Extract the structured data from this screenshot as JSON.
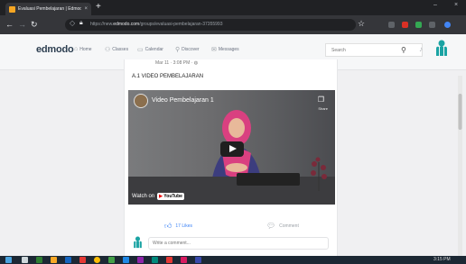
{
  "browser": {
    "tab_title": "Evaluasi Pembelajaran | Edmodo",
    "tab_close": "×",
    "new_tab": "+",
    "url_prefix": "https://new.",
    "url_domain": "edmodo.com",
    "url_path": "/groups/evaluasi-pembelajaran-37355993",
    "window_controls": [
      "–",
      "×"
    ]
  },
  "header": {
    "logo": "edmodo",
    "nav": [
      {
        "label": "Home",
        "icon": "home-icon"
      },
      {
        "label": "Classes",
        "icon": "classes-icon"
      },
      {
        "label": "Calendar",
        "icon": "calendar-icon"
      },
      {
        "label": "Discover",
        "icon": "discover-icon"
      },
      {
        "label": "Messages",
        "icon": "messages-icon"
      }
    ],
    "search_placeholder": "Search"
  },
  "post": {
    "timestamp": "Mar 11 · 3:08 PM ·",
    "text": "A.1 VIDEO PEMBELAJARAN",
    "video": {
      "title": "Video Pembelajaran 1",
      "share_label": "Share",
      "watch_on": "Watch on",
      "yt_you": "You",
      "yt_tube": "Tube"
    },
    "likes": "17 Likes",
    "comment_action": "Comment",
    "comment_placeholder": "Write a comment..."
  },
  "taskbar": {
    "time": "3:15 PM"
  },
  "colors": {
    "accent": "#3b82f6",
    "edmodo_teal": "#1aa3a3",
    "dark_chrome": "#202124"
  }
}
